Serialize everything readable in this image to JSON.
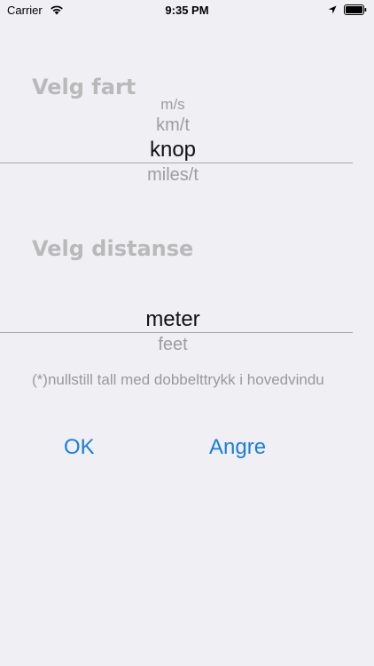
{
  "status_bar": {
    "carrier": "Carrier",
    "time": "9:35 PM",
    "icons": [
      "wifi-icon",
      "location-arrow-icon",
      "battery-icon"
    ]
  },
  "speed_section": {
    "title": "Velg fart",
    "options": [
      "m/s",
      "km/t",
      "knop",
      "miles/t"
    ],
    "selected": "knop"
  },
  "distance_section": {
    "title": "Velg distanse",
    "options": [
      "meter",
      "feet"
    ],
    "selected": "meter"
  },
  "note": "(*)nullstill tall med dobbelttrykk i hovedvindu",
  "buttons": {
    "ok": "OK",
    "cancel": "Angre"
  },
  "colors": {
    "background": "#efeff4",
    "accent": "#1a7ee0",
    "title": "#b9b9b9",
    "picker_inactive": "#9e9e9e",
    "picker_selected": "#111111"
  }
}
